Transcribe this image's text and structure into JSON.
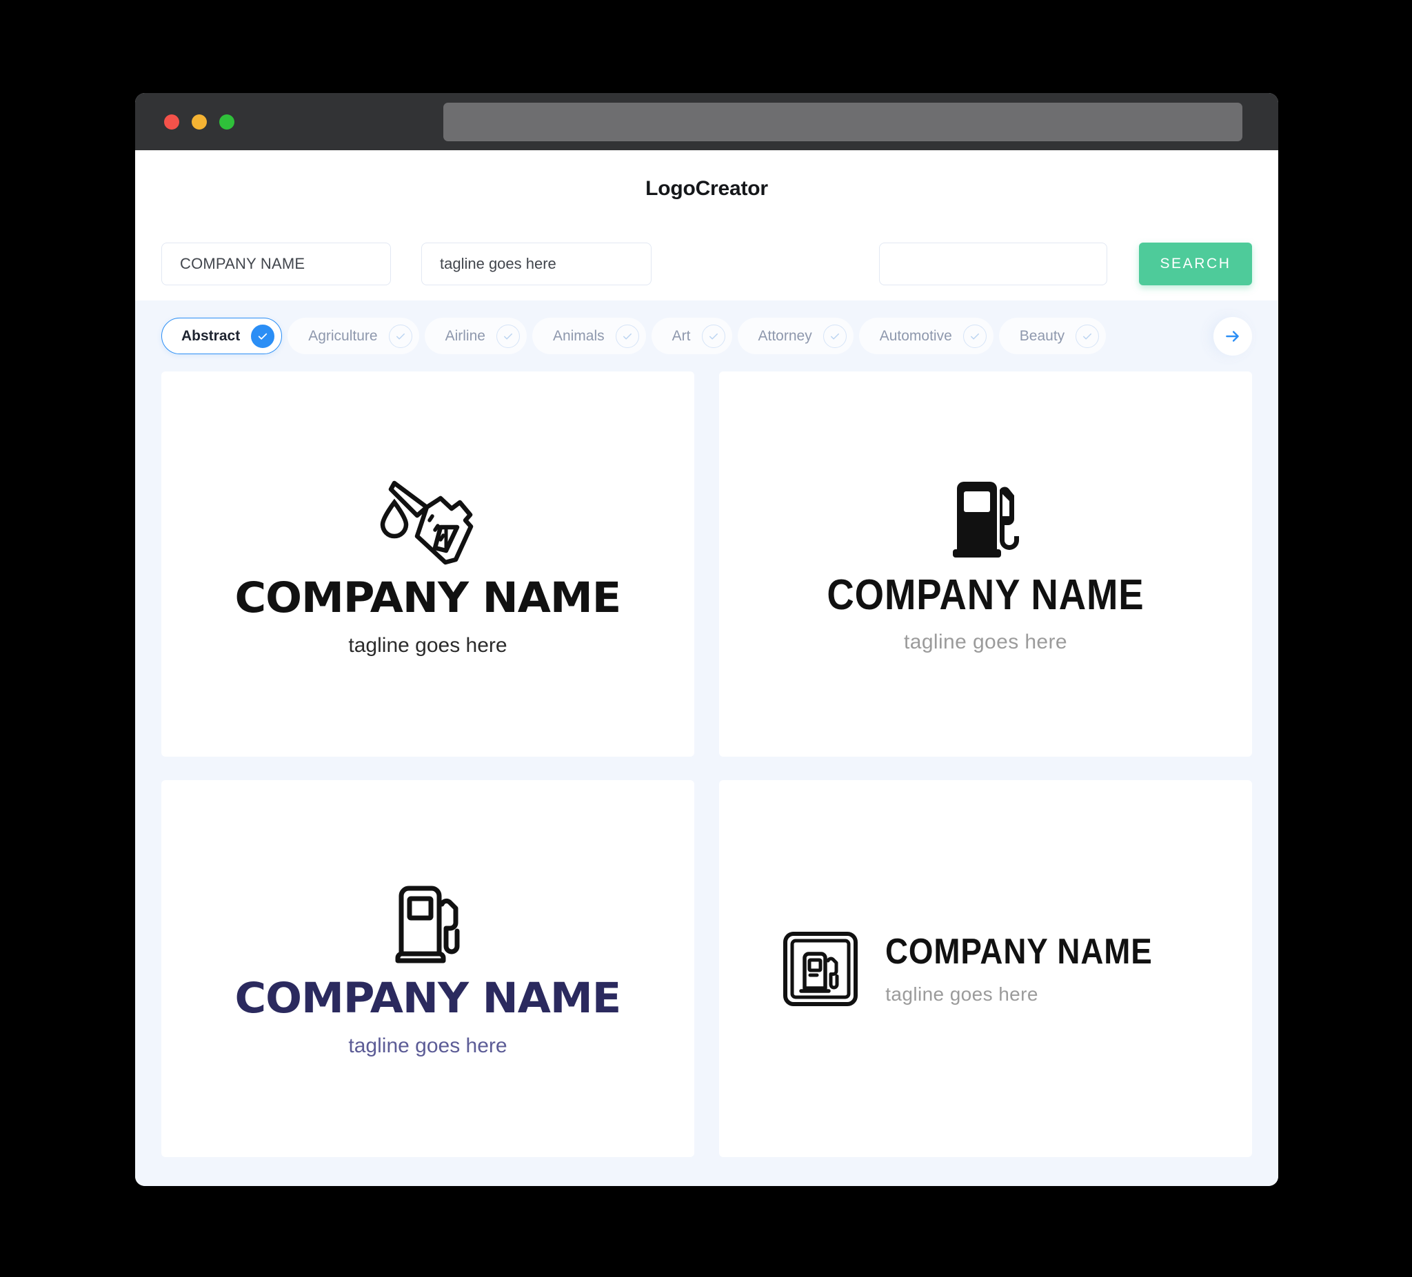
{
  "window": {
    "traffic_lights": [
      "close-red",
      "minimize-yellow",
      "maximize-green"
    ],
    "url_value": ""
  },
  "header": {
    "title": "LogoCreator"
  },
  "search": {
    "company_value": "COMPANY NAME",
    "company_placeholder": "COMPANY NAME",
    "tagline_value": "tagline goes here",
    "tagline_placeholder": "tagline goes here",
    "third_value": "",
    "third_placeholder": "",
    "search_label": "SEARCH",
    "search_color": "#4ECB9A"
  },
  "categories": {
    "accent_color": "#2B8EF5",
    "next_icon": "arrow-right-icon",
    "items": [
      {
        "label": "Abstract",
        "selected": true
      },
      {
        "label": "Agriculture",
        "selected": false
      },
      {
        "label": "Airline",
        "selected": false
      },
      {
        "label": "Animals",
        "selected": false
      },
      {
        "label": "Art",
        "selected": false
      },
      {
        "label": "Attorney",
        "selected": false
      },
      {
        "label": "Automotive",
        "selected": false
      },
      {
        "label": "Beauty",
        "selected": false
      }
    ]
  },
  "results": {
    "cards": [
      {
        "icon": "fuel-nozzle-drip-icon",
        "name": "COMPANY NAME",
        "tagline": "tagline goes here",
        "name_color": "#111111",
        "tagline_color": "#2B2B2B",
        "layout": "stacked"
      },
      {
        "icon": "gas-pump-solid-icon",
        "name": "COMPANY NAME",
        "tagline": "tagline goes here",
        "name_color": "#111111",
        "tagline_color": "#9B9B9B",
        "layout": "stacked"
      },
      {
        "icon": "gas-pump-outline-icon",
        "name": "COMPANY NAME",
        "tagline": "tagline goes here",
        "name_color": "#2B2A5E",
        "tagline_color": "#5C5C96",
        "layout": "stacked"
      },
      {
        "icon": "gas-pump-framed-icon",
        "name": "COMPANY NAME",
        "tagline": "tagline goes here",
        "name_color": "#111111",
        "tagline_color": "#9B9B9B",
        "layout": "horizontal"
      }
    ]
  }
}
